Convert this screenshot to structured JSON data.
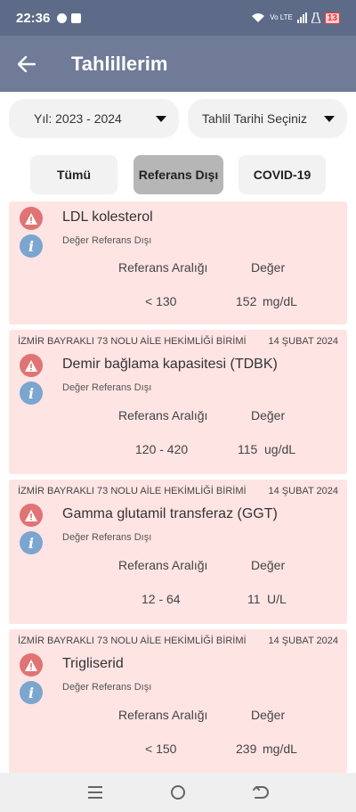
{
  "status_bar": {
    "time": "22:36",
    "network_label": "Vo LTE",
    "battery": "13"
  },
  "app_bar": {
    "title": "Tahlillerim"
  },
  "filters": {
    "year": "Yıl: 2023 - 2024",
    "date": "Tahlil Tarihi Seçiniz"
  },
  "tabs": [
    {
      "label": "Tümü"
    },
    {
      "label": "Referans Dışı"
    },
    {
      "label": "COVID-19"
    }
  ],
  "results": [
    {
      "name": "LDL kolesterol",
      "status": "Değer Referans Dışı",
      "reference_header": "Referans Aralığı",
      "value_header": "Değer",
      "reference": "< 130",
      "value": "152",
      "unit": "mg/dL"
    },
    {
      "institution": "İZMİR BAYRAKLI 73 NOLU AİLE HEKİMLİĞİ BİRİMİ",
      "date": "14 ŞUBAT 2024",
      "name": "Demir bağlama kapasitesi (TDBK)",
      "status": "Değer Referans Dışı",
      "reference_header": "Referans Aralığı",
      "value_header": "Değer",
      "reference": "120 - 420",
      "value": "115",
      "unit": "ug/dL"
    },
    {
      "institution": "İZMİR BAYRAKLI 73 NOLU AİLE HEKİMLİĞİ BİRİMİ",
      "date": "14 ŞUBAT 2024",
      "name": "Gamma glutamil transferaz (GGT)",
      "status": "Değer Referans Dışı",
      "reference_header": "Referans Aralığı",
      "value_header": "Değer",
      "reference": "12 - 64",
      "value": "11",
      "unit": "U/L"
    },
    {
      "institution": "İZMİR BAYRAKLI 73 NOLU AİLE HEKİMLİĞİ BİRİMİ",
      "date": "14 ŞUBAT 2024",
      "name": "Trigliserid",
      "status": "Değer Referans Dışı",
      "reference_header": "Referans Aralığı",
      "value_header": "Değer",
      "reference": "< 150",
      "value": "239",
      "unit": "mg/dL"
    }
  ],
  "colors": {
    "app_bar": "#6f7b97",
    "status_bar": "#5d6b89",
    "card_bg": "#ffe4e4",
    "warning": "#e07373",
    "info": "#7aa6cf",
    "active_tab": "#b6b6b6"
  },
  "icons": [
    "back-arrow-icon",
    "caret-down-icon",
    "warning-icon",
    "info-icon",
    "menu-icon",
    "home-icon",
    "back-nav-icon"
  ]
}
